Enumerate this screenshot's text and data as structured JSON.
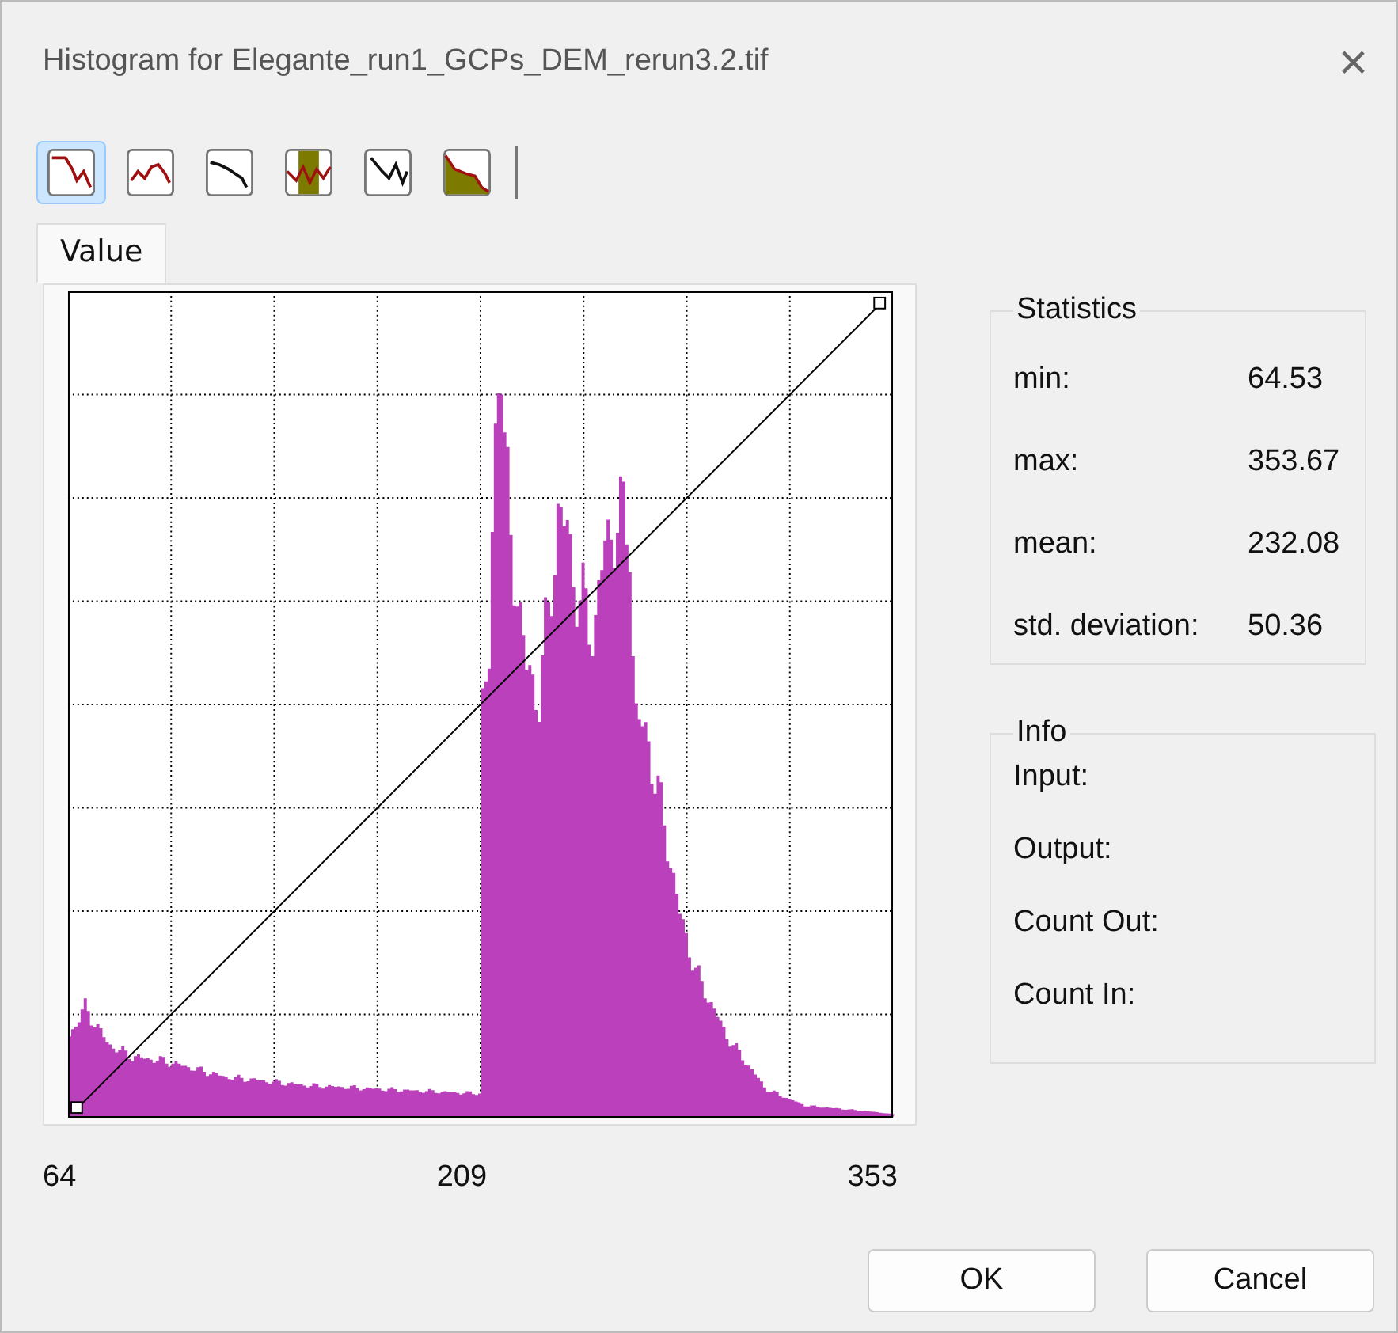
{
  "window": {
    "title": "Histogram for Elegante_run1_GCPs_DEM_rerun3.2.tif",
    "close": "×"
  },
  "toolbar": [
    {
      "kind": "step",
      "selected": true
    },
    {
      "kind": "wave",
      "selected": false
    },
    {
      "kind": "dots",
      "selected": false
    },
    {
      "kind": "band",
      "selected": false
    },
    {
      "kind": "zigzag",
      "selected": false
    },
    {
      "kind": "area",
      "selected": false
    }
  ],
  "tabs": [
    {
      "label": "Value",
      "selected": true
    }
  ],
  "histogram": {
    "x_labels": [
      "64",
      "209",
      "353"
    ]
  },
  "statistics": {
    "title": "Statistics",
    "rows": [
      {
        "label": "min:",
        "value": "64.53"
      },
      {
        "label": "max:",
        "value": "353.67"
      },
      {
        "label": "mean:",
        "value": "232.08"
      },
      {
        "label": "std. deviation:",
        "value": "50.36"
      }
    ]
  },
  "info": {
    "title": "Info",
    "rows": [
      "Input:",
      "Output:",
      "Count Out:",
      "Count In:"
    ]
  },
  "buttons": [
    "OK",
    "Cancel"
  ]
}
